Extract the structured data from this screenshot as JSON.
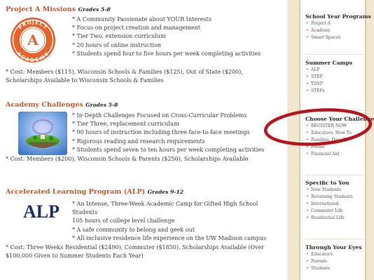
{
  "sections": [
    {
      "title": "Project A Missions",
      "grades": "Grades 5-8",
      "logo": {
        "icon": "project-a-academy-seal",
        "text_top": "PROJECT",
        "text_letter": "A",
        "text_bottom": "ACADEMY",
        "color": "#e8632a"
      },
      "bullets": [
        "* A Community Passionate about YOUR Interests",
        "* Focus on project creation and management",
        "* Tier Two, extension curriculum",
        "* 20 hours of online instruction",
        "* Students spend four to five hours per week completing activities"
      ],
      "cost": [
        "* Cost: Members ($115), Wisconsin Schools & Families ($125), Out of State ($200),",
        "Scholarships Available to Wisconsin Schools & Families"
      ]
    },
    {
      "title": "Academy Challenges",
      "grades": "Grades 5-8",
      "logo": {
        "icon": "academy-challenges-island-image"
      },
      "bullets": [
        "* In-Depth Challenges Focused on Cross-Curricular Problems",
        "* Tier Three, replacement curriculum",
        "* 90 hours of instruction including three face-to-face meetings",
        "* Rigorous reading and research requirements",
        "* Students spend seven to ten hours per week completing activities"
      ],
      "cost": [
        "* Cost: Members ($200), Wisconsin Schools & Parents ($250), Scholarships Available"
      ]
    },
    {
      "title": "Accelerated Learning Program (ALP)",
      "grades": "Grades 9-12",
      "logo": {
        "icon": "alp-logo",
        "text": "ALP",
        "color": "#1a2f6b"
      },
      "bullets": [
        "* An Intense, Three-Week Academic Camp for Gifted High School",
        "Students",
        "105 hours of college level challenge",
        "* A safe community to belong and geek out",
        "* All-inclusive residence life experience on the UW Madison campus"
      ],
      "cost": [
        "* Cost: Three Weeks Residential ($2490), Commuter ($1850), Scholarships Available (Over",
        "$100,000 Given to Summer Students Each Year)"
      ]
    }
  ],
  "sidebar": {
    "groups": [
      {
        "heading": "School Year Programs",
        "items": [
          "Project A",
          "Academy",
          "Smart Spaces"
        ]
      },
      {
        "heading": "Summer Camps",
        "items": [
          "ALP",
          "STEP",
          "YDSP",
          "STEPs"
        ]
      },
      {
        "heading": "Choose Your Challenge",
        "items": [
          "REGISTER NOW",
          "Educators: How To",
          "Families: How To",
          "Forms",
          "Financial Aid"
        ]
      },
      {
        "heading": "Specific to You",
        "items": [
          "New Students",
          "Returning Students",
          "International",
          "Commuter Life",
          "Residential Life"
        ]
      },
      {
        "heading": "Through Your Eyes",
        "items": [
          "Educators",
          "Parents",
          "Students"
        ]
      }
    ],
    "highlight_color": "#b8141c"
  }
}
